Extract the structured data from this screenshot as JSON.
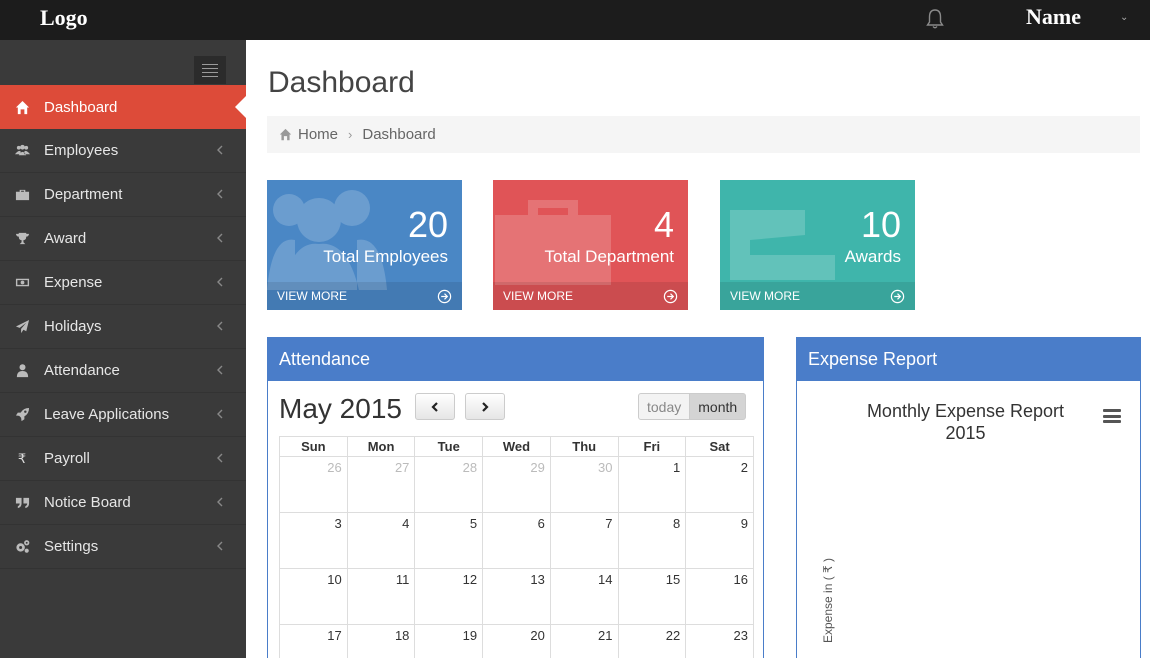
{
  "header": {
    "logo": "Logo",
    "user_name": "Name"
  },
  "sidebar": {
    "items": [
      {
        "label": "Dashboard",
        "icon": "home-icon",
        "active": true
      },
      {
        "label": "Employees",
        "icon": "users-icon"
      },
      {
        "label": "Department",
        "icon": "briefcase-icon"
      },
      {
        "label": "Award",
        "icon": "trophy-icon"
      },
      {
        "label": "Expense",
        "icon": "money-icon"
      },
      {
        "label": "Holidays",
        "icon": "send-icon"
      },
      {
        "label": "Attendance",
        "icon": "user-icon"
      },
      {
        "label": "Leave Applications",
        "icon": "rocket-icon"
      },
      {
        "label": "Payroll",
        "icon": "rupee-icon"
      },
      {
        "label": "Notice Board",
        "icon": "quote-icon"
      },
      {
        "label": "Settings",
        "icon": "gears-icon"
      }
    ]
  },
  "page": {
    "title": "Dashboard",
    "breadcrumb": {
      "home": "Home",
      "current": "Dashboard"
    }
  },
  "cards": [
    {
      "value": "20",
      "label": "Total Employees",
      "link": "VIEW MORE",
      "color": "#4a87c5"
    },
    {
      "value": "4",
      "label": "Total Department",
      "link": "VIEW MORE",
      "color": "#e05457"
    },
    {
      "value": "10",
      "label": "Awards",
      "link": "VIEW MORE",
      "color": "#3fb5ab"
    }
  ],
  "attendance": {
    "title": "Attendance",
    "month_label": "May 2015",
    "today_label": "today",
    "month_view_label": "month",
    "weekdays": [
      "Sun",
      "Mon",
      "Tue",
      "Wed",
      "Thu",
      "Fri",
      "Sat"
    ],
    "weeks": [
      [
        {
          "d": "26",
          "o": true
        },
        {
          "d": "27",
          "o": true
        },
        {
          "d": "28",
          "o": true
        },
        {
          "d": "29",
          "o": true
        },
        {
          "d": "30",
          "o": true
        },
        {
          "d": "1"
        },
        {
          "d": "2"
        }
      ],
      [
        {
          "d": "3"
        },
        {
          "d": "4"
        },
        {
          "d": "5"
        },
        {
          "d": "6"
        },
        {
          "d": "7"
        },
        {
          "d": "8"
        },
        {
          "d": "9"
        }
      ],
      [
        {
          "d": "10"
        },
        {
          "d": "11"
        },
        {
          "d": "12"
        },
        {
          "d": "13"
        },
        {
          "d": "14"
        },
        {
          "d": "15"
        },
        {
          "d": "16"
        }
      ],
      [
        {
          "d": "17"
        },
        {
          "d": "18"
        },
        {
          "d": "19"
        },
        {
          "d": "20"
        },
        {
          "d": "21"
        },
        {
          "d": "22"
        },
        {
          "d": "23"
        }
      ]
    ]
  },
  "expense": {
    "title": "Expense Report",
    "chart_title_line1": "Monthly Expense Report",
    "chart_title_line2": "2015",
    "y_axis_label": "Expense in ( ₹ )"
  },
  "colors": {
    "accent": "#dd4b39",
    "panel_header": "#4a7dc9",
    "sidebar_bg": "#3a3a3a",
    "topbar_bg": "#1c1c1c"
  }
}
